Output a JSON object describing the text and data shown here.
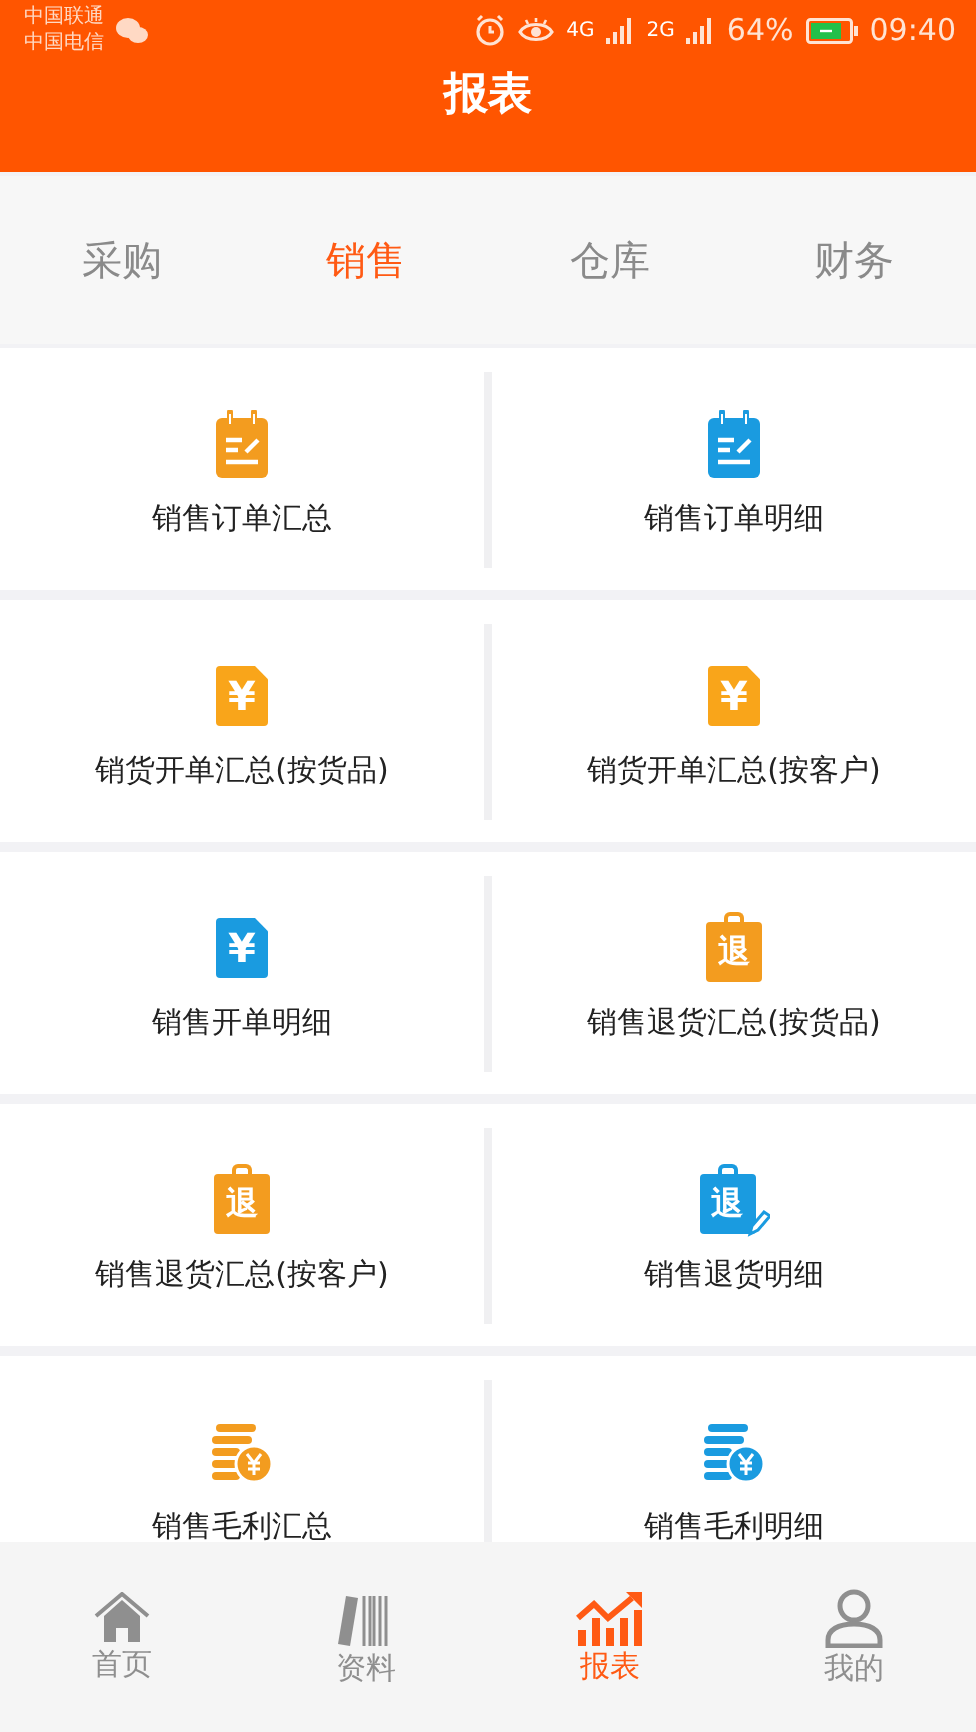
{
  "status_bar": {
    "carriers": [
      "中国联通",
      "中国电信"
    ],
    "network_1": "4G",
    "network_2": "2G",
    "battery": "64%",
    "time": "09:40"
  },
  "header": {
    "title": "报表"
  },
  "tabs": [
    {
      "label": "采购",
      "selected": false
    },
    {
      "label": "销售",
      "selected": true
    },
    {
      "label": "仓库",
      "selected": false
    },
    {
      "label": "财务",
      "selected": false
    }
  ],
  "reports": [
    {
      "label": "销售订单汇总",
      "kind": "notepad",
      "color": "#f39c1f"
    },
    {
      "label": "销售订单明细",
      "kind": "notepad",
      "color": "#1a9be0"
    },
    {
      "label": "销货开单汇总(按货品)",
      "kind": "yen-doc",
      "glyph": "¥",
      "color": "#f9a51a"
    },
    {
      "label": "销货开单汇总(按客户)",
      "kind": "yen-doc",
      "glyph": "¥",
      "color": "#f9a51a"
    },
    {
      "label": "销售开单明细",
      "kind": "yen-doc",
      "glyph": "¥",
      "color": "#1a9be0"
    },
    {
      "label": "销售退货汇总(按货品)",
      "kind": "return",
      "glyph": "退",
      "color": "#f39c1f"
    },
    {
      "label": "销售退货汇总(按客户)",
      "kind": "return",
      "glyph": "退",
      "color": "#f39c1f"
    },
    {
      "label": "销售退货明细",
      "kind": "return-edit",
      "glyph": "退",
      "color": "#1a9be0"
    },
    {
      "label": "销售毛利汇总",
      "kind": "coins",
      "color": "#f39c1f"
    },
    {
      "label": "销售毛利明细",
      "kind": "coins",
      "color": "#1a9be0"
    }
  ],
  "bottom_nav": [
    {
      "label": "首页",
      "kind": "home",
      "selected": false
    },
    {
      "label": "资料",
      "kind": "books",
      "selected": false
    },
    {
      "label": "报表",
      "kind": "chart",
      "selected": true
    },
    {
      "label": "我的",
      "kind": "person",
      "selected": false
    }
  ]
}
